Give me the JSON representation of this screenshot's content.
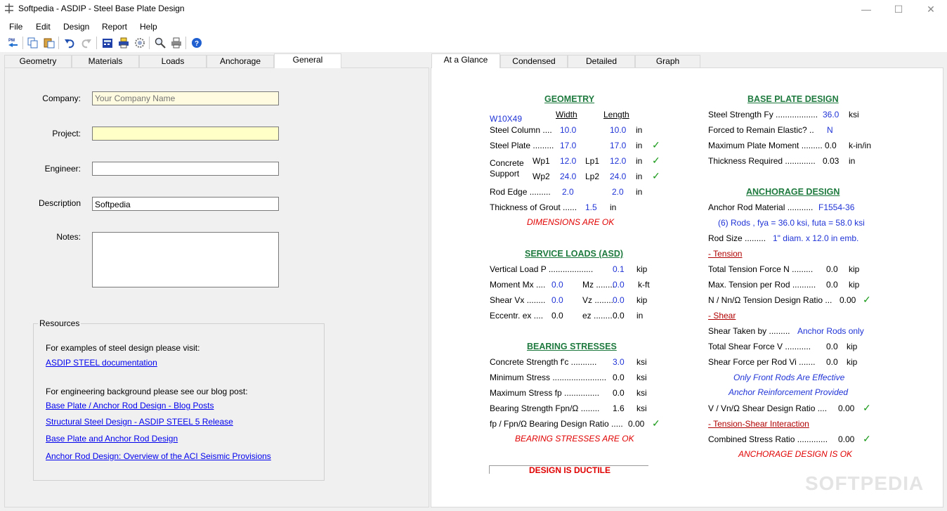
{
  "window": {
    "title": "Softpedia - ASDIP - Steel Base Plate Design"
  },
  "menu": [
    "File",
    "Edit",
    "Design",
    "Report",
    "Help"
  ],
  "toolbar_icons": [
    "pm-icon",
    "copy-icon",
    "paste-icon",
    "undo-icon",
    "redo-icon",
    "calculator-icon",
    "printer-setup-icon",
    "settings-icon",
    "zoom-icon",
    "print-icon",
    "help-icon"
  ],
  "left_tabs": [
    "Geometry",
    "Materials",
    "Loads",
    "Anchorage",
    "General"
  ],
  "right_tabs": [
    "At a Glance",
    "Condensed",
    "Detailed",
    "Graph"
  ],
  "general": {
    "company_label": "Company:",
    "company_placeholder": "Your Company Name",
    "project_label": "Project:",
    "engineer_label": "Engineer:",
    "description_label": "Description",
    "description_value": "Softpedia",
    "notes_label": "Notes:"
  },
  "resources": {
    "title": "Resources",
    "intro1": "For examples of steel design please visit:",
    "link1": "ASDIP STEEL documentation",
    "intro2": "For engineering background please see our blog post:",
    "links": [
      "Base Plate / Anchor Rod Design - Blog Posts",
      "Structural Steel Design - ASDIP STEEL 5 Release",
      "Base Plate and Anchor Rod Design",
      "Anchor Rod Design: Overview of the ACI Seismic Provisions"
    ]
  },
  "glance": {
    "geometry": {
      "title": "GEOMETRY",
      "section": "W10X49",
      "width_hdr": "Width",
      "length_hdr": "Length",
      "col_label": "Steel Column  ....",
      "col_w": "10.0",
      "col_l": "10.0",
      "plate_label": "Steel Plate  .........",
      "plate_w": "17.0",
      "plate_l": "17.0",
      "conc_label1": "Concrete",
      "conc_label2": "Support",
      "wp1": "Wp1",
      "wp1_v": "12.0",
      "lp1": "Lp1",
      "lp1_v": "12.0",
      "wp2": "Wp2",
      "wp2_v": "24.0",
      "lp2": "Lp2",
      "lp2_v": "24.0",
      "edge_label": "Rod Edge  .........",
      "edge_w": "2.0",
      "edge_l": "2.0",
      "grout_label": "Thickness of Grout  ......",
      "grout_v": "1.5",
      "unit_in": "in",
      "ok": "DIMENSIONS ARE OK"
    },
    "loads": {
      "title": "SERVICE LOADS (ASD)",
      "p_label": "Vertical Load  P  ...................",
      "p_v": "0.1",
      "p_u": "kip",
      "m_label": "Moment  Mx  ....",
      "mx_v": "0.0",
      "mz": "Mz  ........",
      "mz_v": "0.0",
      "m_u": "k-ft",
      "v_label": "Shear  Vx  ........",
      "vx_v": "0.0",
      "vz": "Vz  ........",
      "vz_v": "0.0",
      "v_u": "kip",
      "e_label": "Eccentr.  ex  ....",
      "ex_v": "0.0",
      "ez": "ez  ........",
      "ez_v": "0.0",
      "e_u": "in"
    },
    "bearing": {
      "title": "BEARING STRESSES",
      "fc_label": "Concrete Strength  f'c  ...........",
      "fc_v": "3.0",
      "min_label": "Minimum Stress  .......................",
      "min_v": "0.0",
      "max_label": "Maximum Stress  fp  ...............",
      "max_v": "0.0",
      "fpn_label": "Bearing Strength  Fpn/Ω  ........",
      "fpn_v": "1.6",
      "ratio_label": "fp / Fpn/Ω Bearing Design Ratio  .....",
      "ratio_v": "0.00",
      "unit": "ksi",
      "ok": "BEARING STRESSES ARE OK"
    },
    "ductile": "DESIGN IS DUCTILE",
    "baseplate": {
      "title": "BASE PLATE DESIGN",
      "fy_label": "Steel Strength  Fy  ..................",
      "fy_v": "36.0",
      "fy_u": "ksi",
      "elastic_label": "Forced to Remain Elastic?  ..",
      "elastic_v": "N",
      "moment_label": "Maximum Plate Moment  .........",
      "moment_v": "0.0",
      "moment_u": "k-in/in",
      "thick_label": "Thickness Required  .............",
      "thick_v": "0.03",
      "thick_u": "in"
    },
    "anchorage": {
      "title": "ANCHORAGE DESIGN",
      "mat_label": "Anchor Rod Material  ...........",
      "mat_v": "F1554-36",
      "rods_line": "(6)  Rods  ,  fya = 36.0 ksi,   futa = 58.0 ksi",
      "size_label": "Rod Size  .........",
      "size_v": "1\" diam. x 12.0 in emb.",
      "tension_hdr": "- Tension",
      "ttf_label": "Total Tension Force  N  .........",
      "ttf_v": "0.0",
      "ttf_u": "kip",
      "mtr_label": "Max. Tension per Rod  ..........",
      "mtr_v": "0.0",
      "mtr_u": "kip",
      "ntr_label": "N / Nn/Ω Tension Design Ratio  ...",
      "ntr_v": "0.00",
      "shear_hdr": "- Shear",
      "stb_label": "Shear Taken by  .........",
      "stb_v": "Anchor Rods only",
      "tsf_label": "Total Shear Force  V  ...........",
      "tsf_v": "0.0",
      "tsf_u": "kip",
      "sfr_label": "Shear Force per Rod  Vi  .......",
      "sfr_v": "0.0",
      "sfr_u": "kip",
      "note1": "Only Front Rods Are Effective",
      "note2": "Anchor Reinforcement Provided",
      "vr_label": "V / Vn/Ω Shear Design Ratio  ....",
      "vr_v": "0.00",
      "ts_hdr": "- Tension-Shear Interaction",
      "csr_label": "Combined Stress Ratio  .............",
      "csr_v": "0.00",
      "ok": "ANCHORAGE DESIGN IS OK"
    }
  },
  "watermark": "SOFTPEDIA",
  "check_mark": "✓"
}
